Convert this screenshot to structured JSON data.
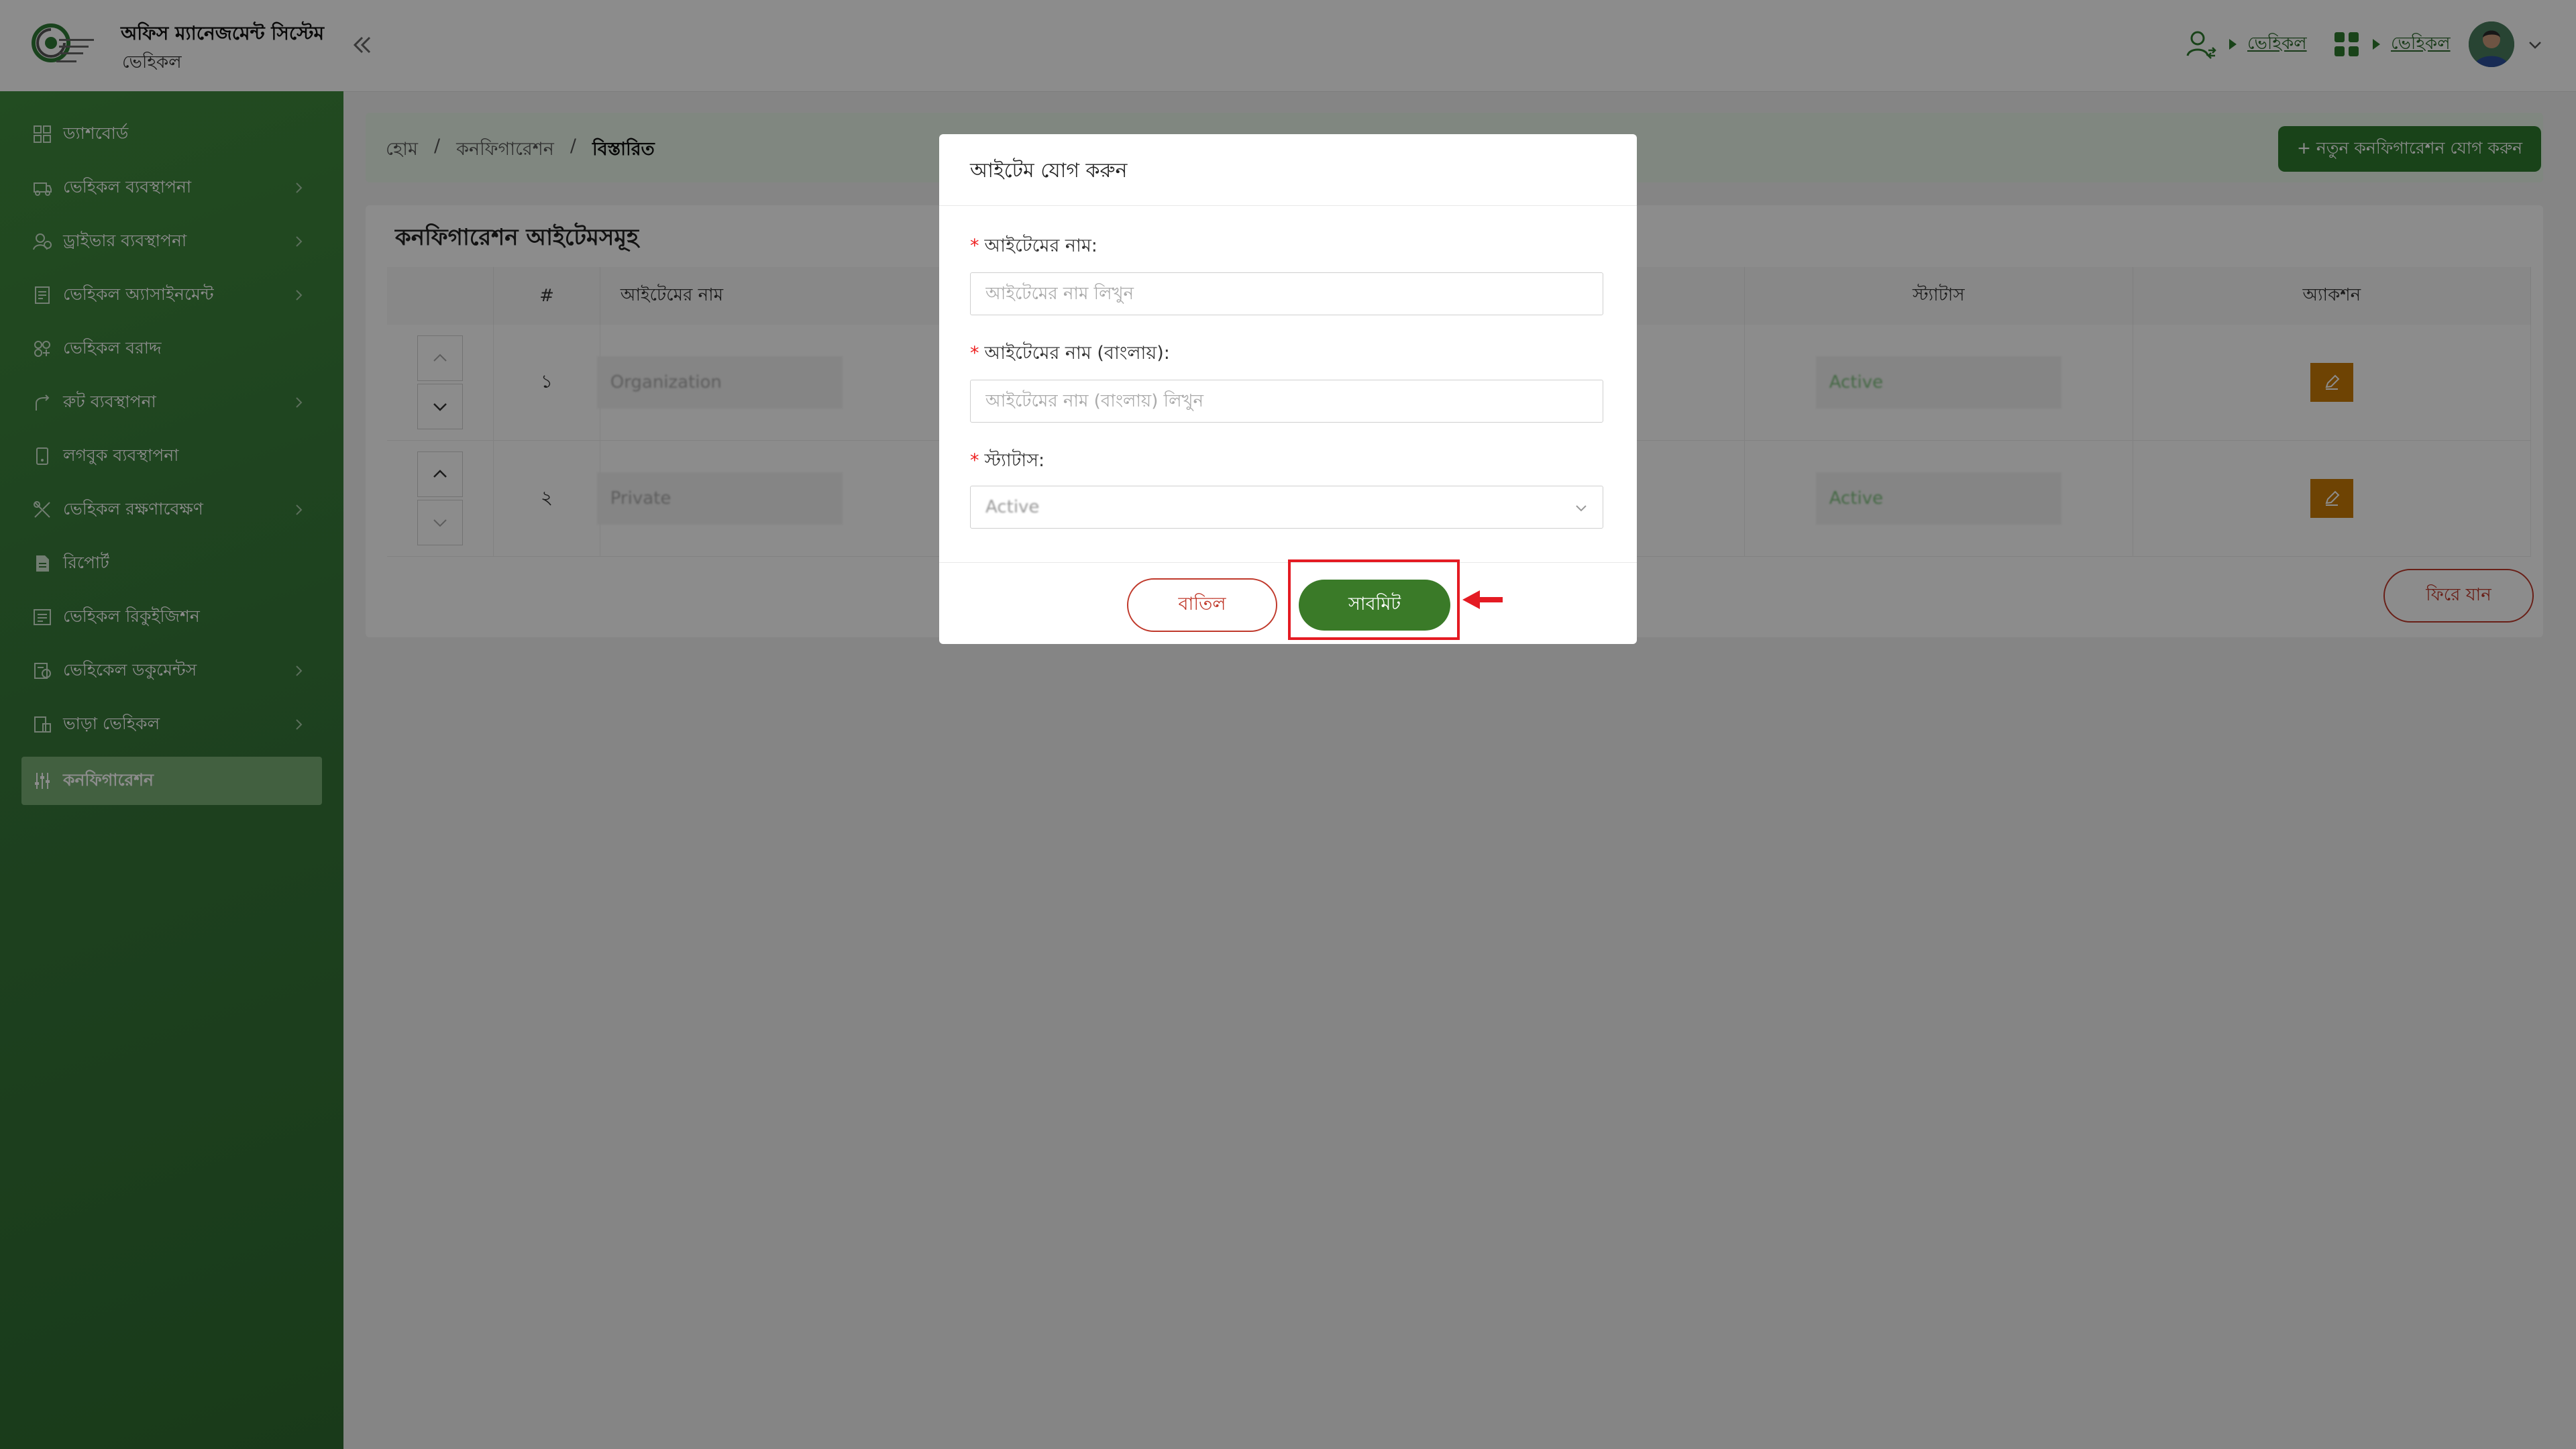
{
  "header": {
    "app_title": "অফিস ম্যানেজমেন্ট সিস্টেম",
    "app_subtitle": "ভেহিকল",
    "switch_link": "ভেহিকল",
    "module_link": "ভেহিকল"
  },
  "sidebar": {
    "items": [
      {
        "label": "ড্যাশবোর্ড",
        "icon": "dashboard-icon"
      },
      {
        "label": "ভেহিকল ব্যবস্থাপনা",
        "icon": "vehicle-icon"
      },
      {
        "label": "ড্রাইভার ব্যবস্থাপনা",
        "icon": "driver-icon"
      },
      {
        "label": "ভেহিকল অ্যাসাইনমেন্ট",
        "icon": "assignment-icon"
      },
      {
        "label": "ভেহিকল বরাদ্দ",
        "icon": "allocation-icon"
      },
      {
        "label": "রুট ব্যবস্থাপনা",
        "icon": "route-icon"
      },
      {
        "label": "লগবুক ব্যবস্থাপনা",
        "icon": "logbook-icon"
      },
      {
        "label": "ভেহিকল রক্ষণাবেক্ষণ",
        "icon": "maintenance-icon"
      },
      {
        "label": "রিপোর্ট",
        "icon": "report-icon"
      },
      {
        "label": "ভেহিকল রিকুইজিশন",
        "icon": "requisition-icon"
      },
      {
        "label": "ভেহিকেল ডকুমেন্টস",
        "icon": "documents-icon"
      },
      {
        "label": "ভাড়া ভেহিকল",
        "icon": "rental-icon"
      },
      {
        "label": "কনফিগারেশন",
        "icon": "configuration-icon"
      }
    ]
  },
  "breadcrumb": {
    "home": "হোম",
    "sep": "/",
    "section": "কনফিগারেশন",
    "current": "বিস্তারিত"
  },
  "actions": {
    "new_config": "+ নতুন কনফিগারেশন যোগ করুন",
    "back": "ফিরে যান"
  },
  "table": {
    "title": "কনফিগারেশন আইটেমসমূহ",
    "columns": [
      "",
      "#",
      "আইটেমের নাম",
      "স্ট্যাটাস",
      "অ্যাকশন"
    ],
    "rows": [
      {
        "num": "১",
        "name": "Organization",
        "status": "Active"
      },
      {
        "num": "২",
        "name": "Private",
        "status": "Active"
      }
    ]
  },
  "modal": {
    "title": "আইটেম যোগ করুন",
    "required_mark": "*",
    "name_label": "আইটেমের নাম:",
    "name_placeholder": "আইটেমের নাম লিখুন",
    "name_bn_label": "আইটেমের নাম (বাংলায়):",
    "name_bn_placeholder": "আইটেমের নাম (বাংলায়) লিখুন",
    "status_label": "স্ট্যাটাস:",
    "status_value": "Active",
    "cancel": "বাতিল",
    "submit": "সাবমিট"
  },
  "colors": {
    "sidebar_green": "#37783a",
    "accent_green": "#2e7a2e",
    "submit_green": "#3a7a28",
    "danger_red": "#c0392b",
    "edit_orange": "#c97b07",
    "highlight_red": "#e41b23"
  }
}
